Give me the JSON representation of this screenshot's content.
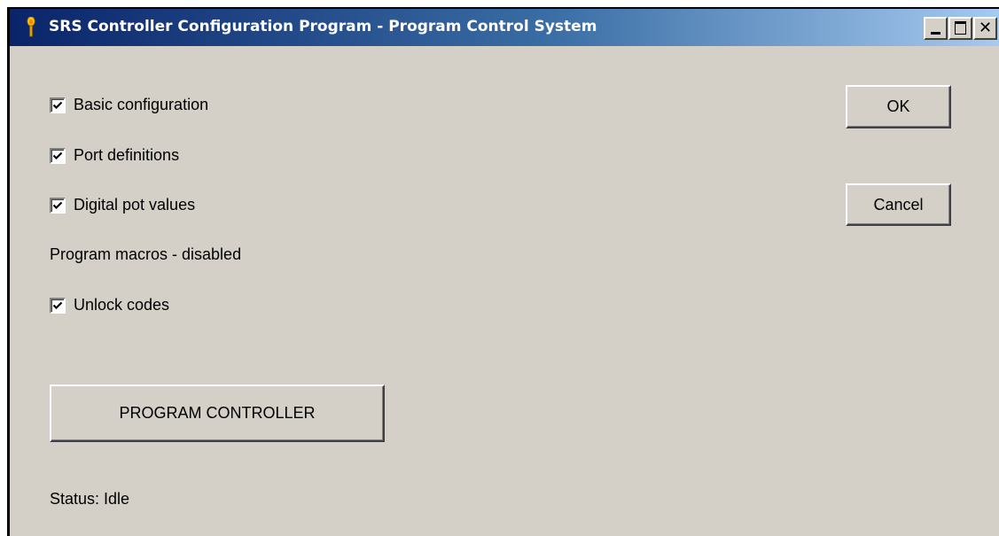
{
  "window": {
    "title": "SRS Controller Configuration Program - Program Control System",
    "icon": "torch-icon",
    "caption_buttons": {
      "minimize": "minimize-icon",
      "maximize": "maximize-icon",
      "close": "close-icon",
      "close_glyph": "✕"
    }
  },
  "options": {
    "basic_configuration": {
      "label": "Basic configuration",
      "checked": true
    },
    "port_definitions": {
      "label": "Port definitions",
      "checked": true
    },
    "digital_pot_values": {
      "label": "Digital pot values",
      "checked": true
    },
    "program_macros_label": "Program macros - disabled",
    "unlock_codes": {
      "label": "Unlock codes",
      "checked": true
    }
  },
  "buttons": {
    "ok": "OK",
    "cancel": "Cancel",
    "program_controller": "PROGRAM CONTROLLER"
  },
  "status": {
    "text": "Status: Idle"
  },
  "colors": {
    "face": "#d4d0c8",
    "titlebar_start": "#0a246a",
    "titlebar_end": "#a6caf0"
  }
}
